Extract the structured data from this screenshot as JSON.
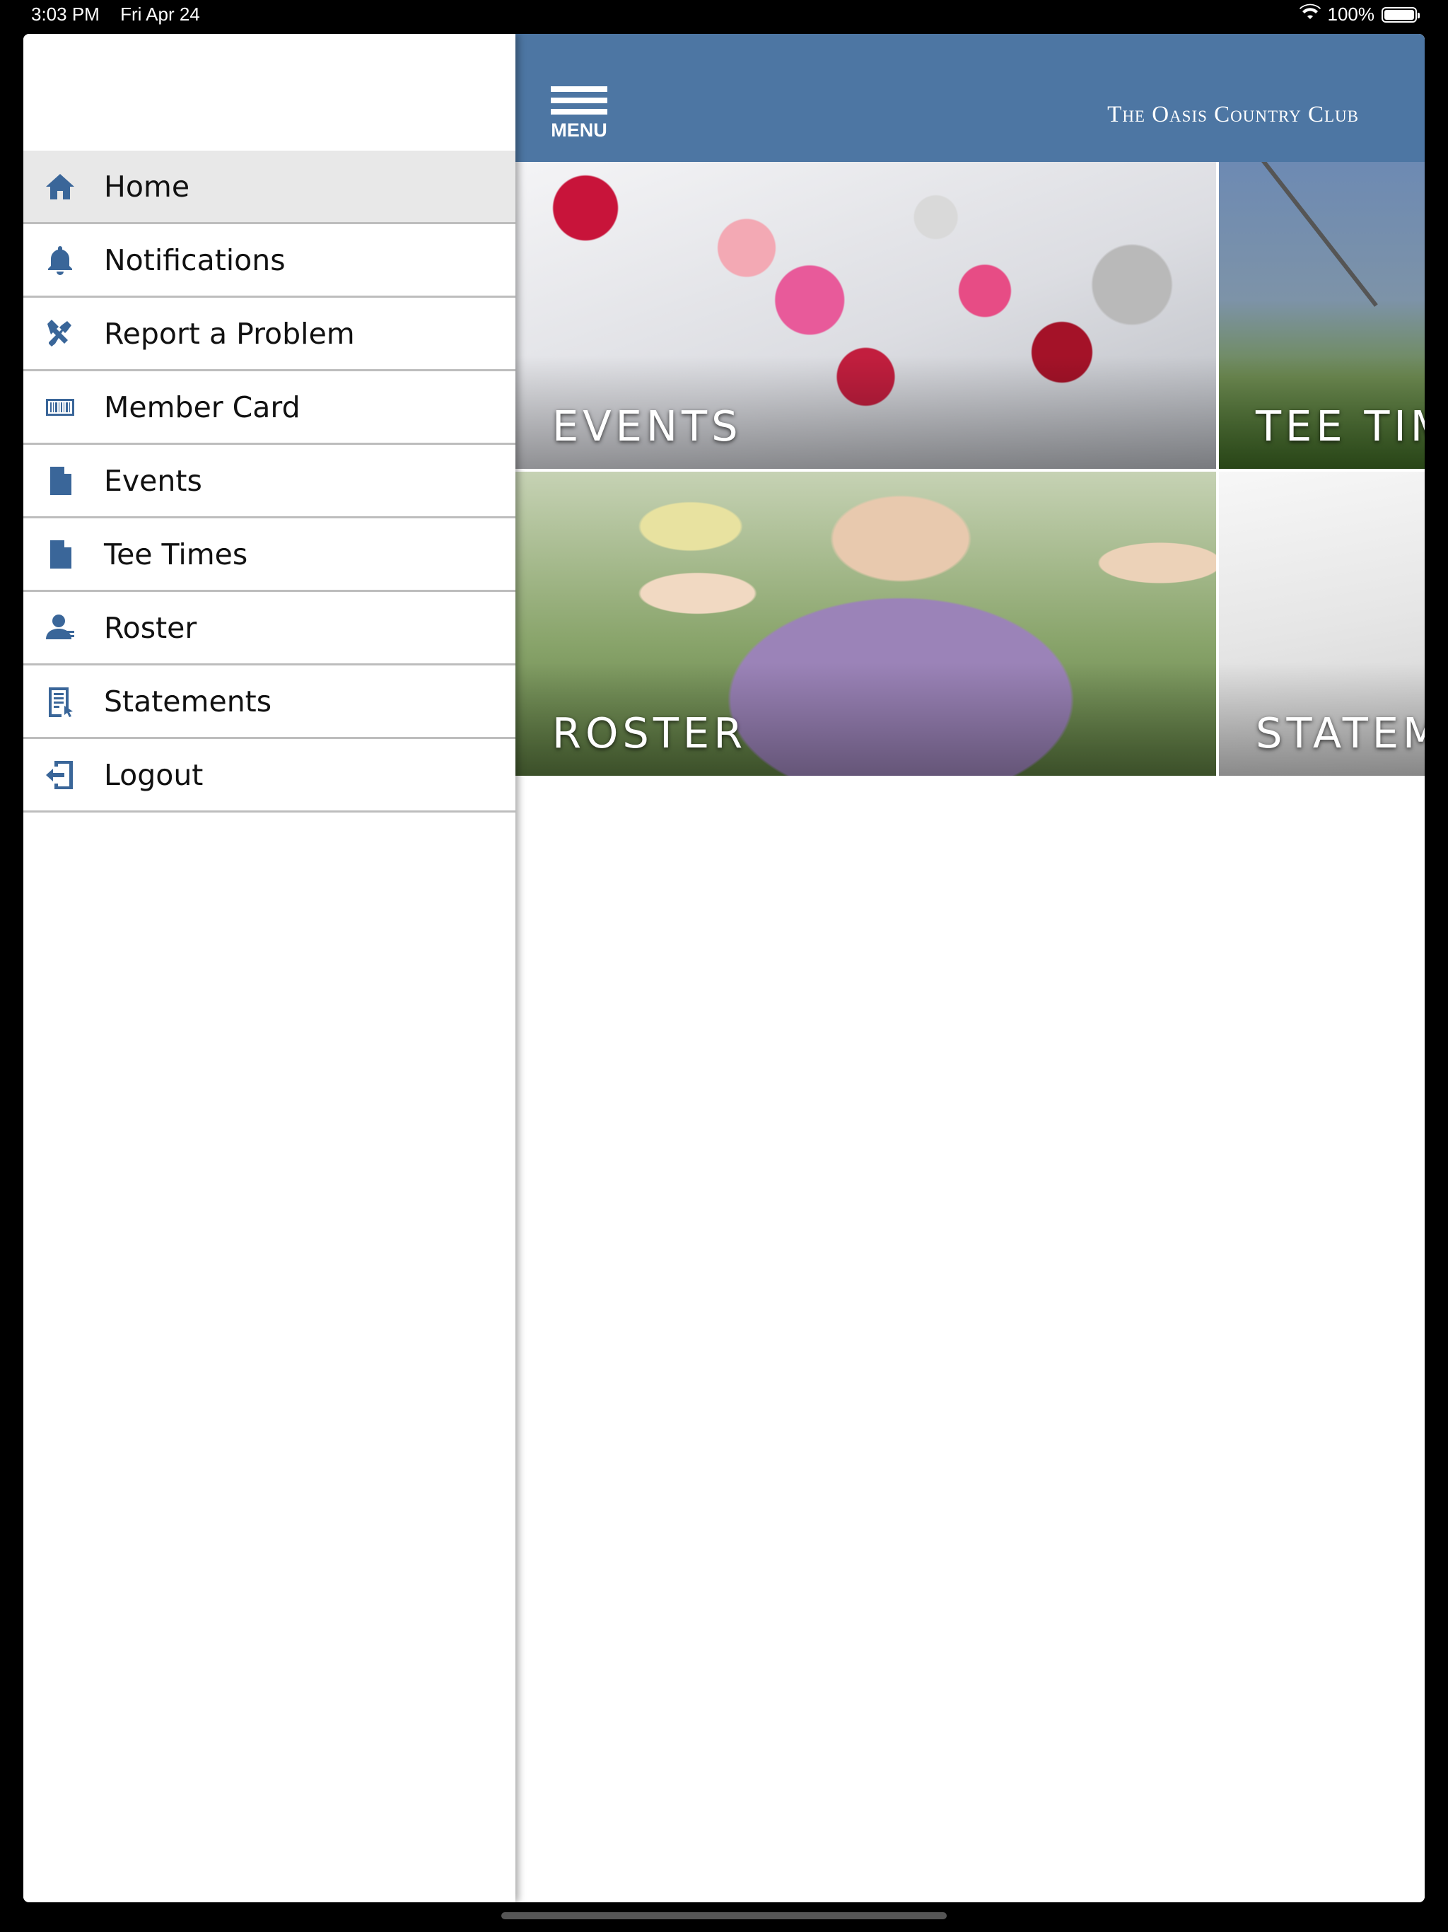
{
  "status_bar": {
    "time": "3:03 PM",
    "date": "Fri Apr 24",
    "battery": "100%"
  },
  "sidebar": {
    "items": [
      {
        "label": "Home",
        "icon": "home-icon"
      },
      {
        "label": "Notifications",
        "icon": "bell-icon"
      },
      {
        "label": "Report a Problem",
        "icon": "tools-icon"
      },
      {
        "label": "Member Card",
        "icon": "barcode-icon"
      },
      {
        "label": "Events",
        "icon": "document-icon"
      },
      {
        "label": "Tee Times",
        "icon": "document-icon"
      },
      {
        "label": "Roster",
        "icon": "person-icon"
      },
      {
        "label": "Statements",
        "icon": "statement-icon"
      },
      {
        "label": "Logout",
        "icon": "logout-icon"
      }
    ],
    "active_index": 0
  },
  "header": {
    "menu_label": "MENU",
    "club_name": "The Oasis Country Club"
  },
  "tiles": {
    "events": "EVENTS",
    "tee_times": "TEE TIM",
    "roster": "ROSTER",
    "statements": "STATEM"
  },
  "colors": {
    "header": "#4d76a3",
    "icon": "#3a6699",
    "active_row": "#e8e8e8"
  }
}
